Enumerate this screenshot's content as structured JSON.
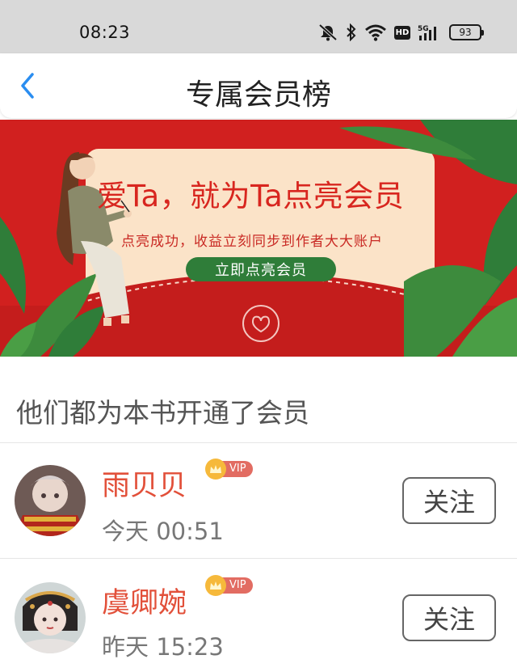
{
  "status_bar": {
    "time": "08:23",
    "icons": [
      "mute-icon",
      "bluetooth-icon",
      "wifi-icon",
      "hd-icon",
      "5g-signal-icon",
      "battery-icon"
    ],
    "hd_label": "HD",
    "network_label": "5G",
    "battery_level": "93"
  },
  "header": {
    "back_icon": "chevron-left-icon",
    "title": "专属会员榜"
  },
  "banner": {
    "headline": "爱Ta，就为Ta点亮会员",
    "subline": "点亮成功，收益立刻同步到作者大大账户",
    "cta_label": "立即点亮会员",
    "colors": {
      "background": "#d1201f",
      "card": "#fbe3c8",
      "cta": "#2f7d39",
      "leaf": "#3d8b3d"
    }
  },
  "section": {
    "title": "他们都为本书开通了会员"
  },
  "members": [
    {
      "name": "雨贝贝",
      "badge": "VIP",
      "time": "今天 00:51",
      "follow_label": "关注"
    },
    {
      "name": "虞卿婉",
      "badge": "VIP",
      "time": "昨天 15:23",
      "follow_label": "关注"
    }
  ],
  "colors": {
    "accent_name": "#e2503a",
    "vip_badge": "#e26c62",
    "vip_crown": "#f6b93b",
    "back_icon": "#2a8df0"
  }
}
